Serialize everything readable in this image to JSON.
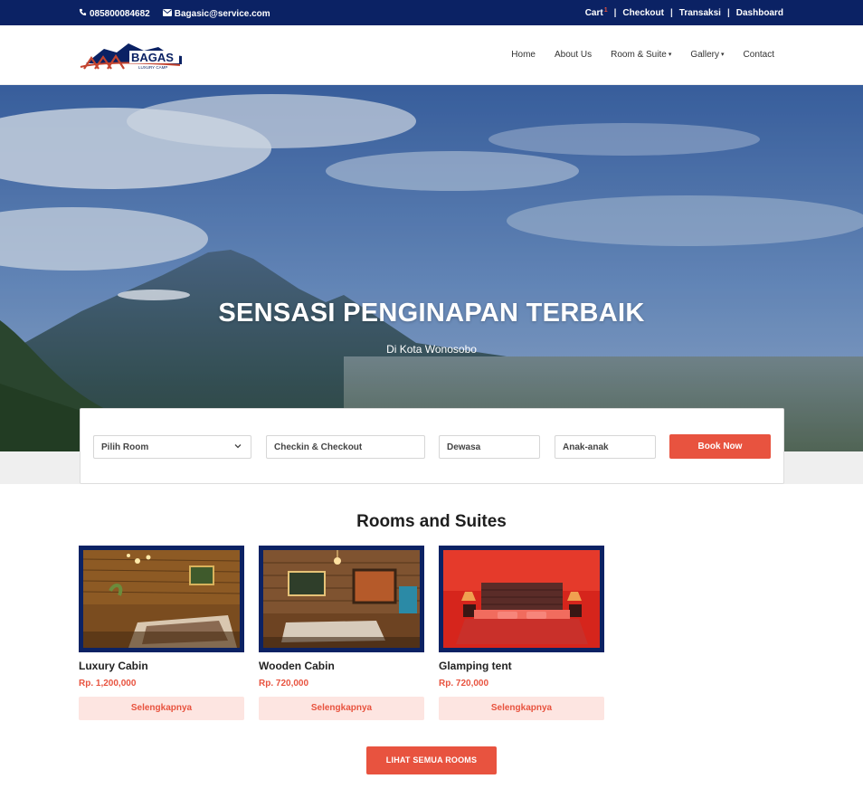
{
  "topbar": {
    "phone": "085800084682",
    "email": "Bagasic@service.com",
    "links": [
      "Cart",
      "Checkout",
      "Transaksi",
      "Dashboard"
    ],
    "cart_badge": "1",
    "separator": "|"
  },
  "brand": {
    "logo_text": "BAGAS",
    "logo_subtext": "LUXURY CAMP",
    "logo_icon": "mountain-cabin-logo"
  },
  "nav": {
    "home": "Home",
    "about": "About Us",
    "rooms": "Room & Suite",
    "gallery": "Gallery",
    "contact": "Contact",
    "caret": "▾"
  },
  "hero": {
    "title": "SENSASI PENGINAPAN TERBAIK",
    "subtitle": "Di Kota Wonosobo"
  },
  "booking": {
    "room_placeholder": "Pilih Room",
    "date_placeholder": "Checkin & Checkout",
    "adult_placeholder": "Dewasa",
    "kid_placeholder": "Anak-anak",
    "submit": "Book Now"
  },
  "rooms": {
    "title": "Rooms and Suites",
    "items": [
      {
        "name": "Luxury Cabin",
        "price": "Rp. 1,200,000",
        "cta": "Selengkapnya"
      },
      {
        "name": "Wooden Cabin",
        "price": "Rp. 720,000",
        "cta": "Selengkapnya"
      },
      {
        "name": "Glamping tent",
        "price": "Rp. 720,000",
        "cta": "Selengkapnya"
      }
    ],
    "see_all": "LIHAT SEMUA ROOMS"
  },
  "colors": {
    "navy": "#0b2264",
    "accent": "#e8533f",
    "accent_light": "#fde5e1"
  }
}
